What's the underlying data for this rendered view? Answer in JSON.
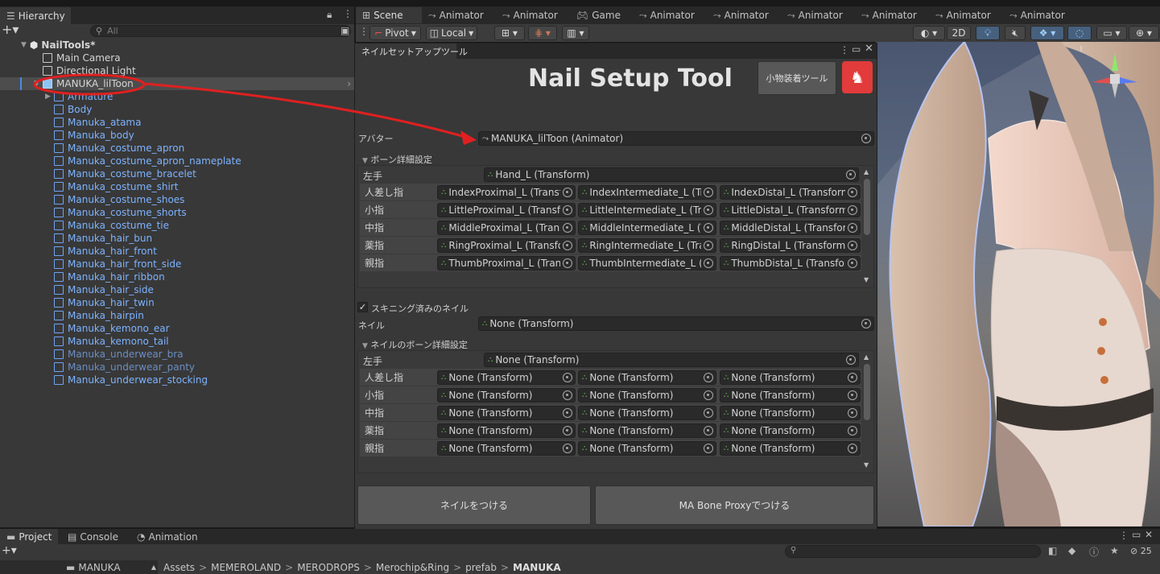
{
  "hierarchy": {
    "tab": "Hierarchy",
    "search_placeholder": "All",
    "root": "NailTools*",
    "items": [
      {
        "label": "Main Camera",
        "style": "white"
      },
      {
        "label": "Directional Light",
        "style": "white"
      },
      {
        "label": "MANUKA_lilToon",
        "style": "selected"
      },
      {
        "label": "Armature",
        "style": "blue"
      },
      {
        "label": "Body",
        "style": "blue"
      },
      {
        "label": "Manuka_atama",
        "style": "blue"
      },
      {
        "label": "Manuka_body",
        "style": "blue"
      },
      {
        "label": "Manuka_costume_apron",
        "style": "blue"
      },
      {
        "label": "Manuka_costume_apron_nameplate",
        "style": "blue"
      },
      {
        "label": "Manuka_costume_bracelet",
        "style": "blue"
      },
      {
        "label": "Manuka_costume_shirt",
        "style": "blue"
      },
      {
        "label": "Manuka_costume_shoes",
        "style": "blue"
      },
      {
        "label": "Manuka_costume_shorts",
        "style": "blue"
      },
      {
        "label": "Manuka_costume_tie",
        "style": "blue"
      },
      {
        "label": "Manuka_hair_bun",
        "style": "blue"
      },
      {
        "label": "Manuka_hair_front",
        "style": "blue"
      },
      {
        "label": "Manuka_hair_front_side",
        "style": "blue"
      },
      {
        "label": "Manuka_hair_ribbon",
        "style": "blue"
      },
      {
        "label": "Manuka_hair_side",
        "style": "blue"
      },
      {
        "label": "Manuka_hair_twin",
        "style": "blue"
      },
      {
        "label": "Manuka_hairpin",
        "style": "blue"
      },
      {
        "label": "Manuka_kemono_ear",
        "style": "blue"
      },
      {
        "label": "Manuka_kemono_tail",
        "style": "blue"
      },
      {
        "label": "Manuka_underwear_bra",
        "style": "gray"
      },
      {
        "label": "Manuka_underwear_panty",
        "style": "gray"
      },
      {
        "label": "Manuka_underwear_stocking",
        "style": "blue"
      }
    ]
  },
  "tabs": [
    "Scene",
    "Animator",
    "Animator",
    "Game",
    "Animator",
    "Animator",
    "Animator",
    "Animator",
    "Animator",
    "Animator"
  ],
  "scene_toolbar": {
    "pivot": "Pivot",
    "local": "Local",
    "mode2d": "2D"
  },
  "tool": {
    "tab": "ネイルセットアップツール",
    "title": "Nail Setup Tool",
    "accessory_button": "小物装着ツール",
    "avatar_label": "アバター",
    "avatar_value": "MANUKA_lilToon (Animator)",
    "bone_section": "ボーン詳細設定",
    "left_hand_label": "左手",
    "left_hand_value": "Hand_L (Transform)",
    "fingers": [
      {
        "label": "人差し指",
        "vals": [
          "IndexProximal_L (Transfo",
          "IndexIntermediate_L (Tra",
          "IndexDistal_L (Transform"
        ]
      },
      {
        "label": "小指",
        "vals": [
          "LittleProximal_L (Transfo",
          "LittleIntermediate_L (Tra",
          "LittleDistal_L (Transform)"
        ]
      },
      {
        "label": "中指",
        "vals": [
          "MiddleProximal_L (Trans",
          "MiddleIntermediate_L (Tr",
          "MiddleDistal_L (Transforn"
        ]
      },
      {
        "label": "薬指",
        "vals": [
          "RingProximal_L (Transfor",
          "RingIntermediate_L (Tran",
          "RingDistal_L (Transform)"
        ]
      },
      {
        "label": "親指",
        "vals": [
          "ThumbProximal_L (Trans",
          "ThumbIntermediate_L (Tr",
          "ThumbDistal_L (Transfor"
        ]
      }
    ],
    "skinned_label": "スキニング済みのネイル",
    "nail_label": "ネイル",
    "nail_value": "None (Transform)",
    "nail_bone_section": "ネイルのボーン詳細設定",
    "nail_left_hand_label": "左手",
    "nail_left_hand_value": "None (Transform)",
    "nail_fingers": [
      {
        "label": "人差し指",
        "vals": [
          "None (Transform)",
          "None (Transform)",
          "None (Transform)"
        ]
      },
      {
        "label": "小指",
        "vals": [
          "None (Transform)",
          "None (Transform)",
          "None (Transform)"
        ]
      },
      {
        "label": "中指",
        "vals": [
          "None (Transform)",
          "None (Transform)",
          "None (Transform)"
        ]
      },
      {
        "label": "薬指",
        "vals": [
          "None (Transform)",
          "None (Transform)",
          "None (Transform)"
        ]
      },
      {
        "label": "親指",
        "vals": [
          "None (Transform)",
          "None (Transform)",
          "None (Transform)"
        ]
      }
    ],
    "attach_button": "ネイルをつける",
    "ma_button": "MA Bone Proxyでつける"
  },
  "bottom": {
    "tabs": [
      "Project",
      "Console",
      "Animation"
    ],
    "folder": "MANUKA",
    "breadcrumb": [
      "Assets",
      "MEMEROLAND",
      "MERODROPS",
      "Merochip&Ring",
      "prefab",
      "MANUKA"
    ],
    "hidden_count": "25"
  }
}
